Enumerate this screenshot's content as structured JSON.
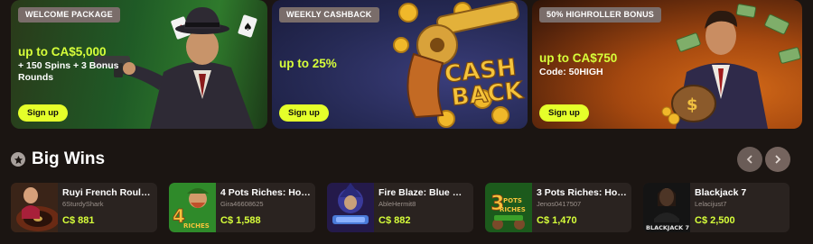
{
  "promos": [
    {
      "badge": "WELCOME PACKAGE",
      "amount": "up to CA$5,000",
      "sub_line1": "+ 150 Spins + 3 Bonus",
      "sub_line2": "Rounds",
      "cta": "Sign up"
    },
    {
      "badge": "WEEKLY CASHBACK",
      "amount": "up to 25%",
      "art_text_1": "CASH",
      "art_text_2": "BACK",
      "cta": "Sign up"
    },
    {
      "badge": "50% HIGHROLLER BONUS",
      "amount": "up to CA$750",
      "code": "Code: 50HIGH",
      "cta": "Sign up"
    }
  ],
  "big_wins": {
    "title": "Big Wins",
    "icon": "star-icon",
    "items": [
      {
        "game": "Ruyi French Roulette",
        "user": "6SturdyShark",
        "amount": "C$ 881"
      },
      {
        "game": "4 Pots Riches: Hold ...",
        "user": "Gira46608625",
        "amount": "C$ 1,588",
        "thumb_text": "RICHES"
      },
      {
        "game": "Fire Blaze: Blue Wiz...",
        "user": "AbleHermit8",
        "amount": "C$ 882"
      },
      {
        "game": "3 Pots Riches: Hold a...",
        "user": "Jenos0417507",
        "amount": "C$ 1,470",
        "thumb_text": "RICHES"
      },
      {
        "game": "Blackjack 7",
        "user": "Lelacijust7",
        "amount": "C$ 2,500",
        "thumb_text": "BLACKJACK 7"
      }
    ]
  },
  "colors": {
    "accent": "#d7ff3a",
    "cta": "#e5ff2a",
    "background": "#1b1512",
    "card": "#2a2320"
  }
}
